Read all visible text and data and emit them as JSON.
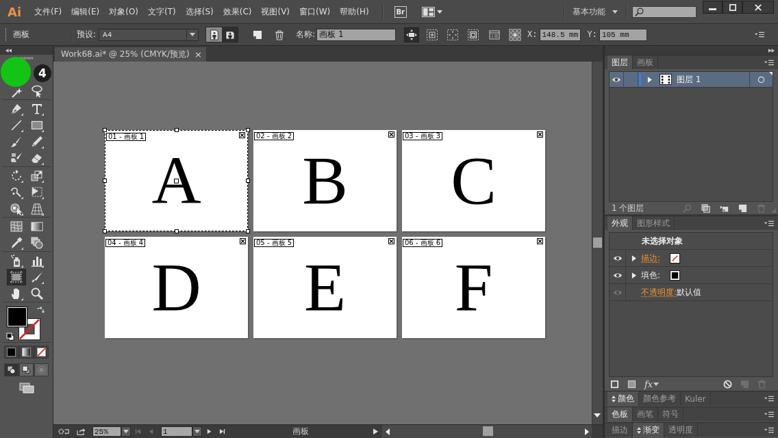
{
  "app": {
    "logo": "Ai"
  },
  "menu": [
    "文件(F)",
    "编辑(E)",
    "对象(O)",
    "文字(T)",
    "选择(S)",
    "效果(C)",
    "视图(V)",
    "窗口(W)",
    "帮助(H)"
  ],
  "title_bar": {
    "bridge": "Br",
    "workspace": "基本功能"
  },
  "control_bar": {
    "title": "画板",
    "preset_label": "预设:",
    "preset": "A4",
    "orientation": [
      {
        "kind": "portrait",
        "selected": false
      },
      {
        "kind": "landscape",
        "selected": true
      }
    ],
    "name_label": "名称:",
    "name": "画板 1",
    "toggles": [
      {
        "kind": "move",
        "selected": true
      },
      {
        "kind": "center",
        "selected": false
      },
      {
        "kind": "crosshair",
        "selected": false
      },
      {
        "kind": "safe",
        "selected": false
      }
    ],
    "x_label": "X:",
    "x": "148.5 mm",
    "y_label": "Y:",
    "y": "105 mm"
  },
  "document": {
    "tab": "Work68.ai* @ 25% (CMYK/预览)",
    "close": "×"
  },
  "tools": [
    {
      "kind": "wand",
      "selected": false
    },
    {
      "kind": "lasso",
      "selected": false
    },
    {
      "kind": "pen",
      "selected": false
    },
    {
      "kind": "type",
      "selected": false
    },
    {
      "kind": "line",
      "selected": false
    },
    {
      "kind": "rect",
      "selected": false
    },
    {
      "kind": "brush",
      "selected": false
    },
    {
      "kind": "pencil",
      "selected": false
    },
    {
      "kind": "blob",
      "selected": false
    },
    {
      "kind": "eraser",
      "selected": false
    },
    {
      "kind": "rotate",
      "selected": false
    },
    {
      "kind": "scale",
      "selected": false
    },
    {
      "kind": "warp",
      "selected": false
    },
    {
      "kind": "transform",
      "selected": false
    },
    {
      "kind": "shapebuilder",
      "selected": false
    },
    {
      "kind": "perspective",
      "selected": false
    },
    {
      "kind": "mesh",
      "selected": false
    },
    {
      "kind": "gradient",
      "selected": false
    },
    {
      "kind": "eyedropper",
      "selected": false
    },
    {
      "kind": "blend",
      "selected": false
    },
    {
      "kind": "spray",
      "selected": false
    },
    {
      "kind": "graph",
      "selected": false
    },
    {
      "kind": "artboard",
      "selected": true
    },
    {
      "kind": "slice",
      "selected": false
    },
    {
      "kind": "hand",
      "selected": false
    },
    {
      "kind": "zoom",
      "selected": false
    }
  ],
  "colors": {
    "fill": {
      "kind": "solid",
      "color": "#000000"
    },
    "stroke": {
      "kind": "none"
    }
  },
  "color_modes": [
    {
      "kind": "color"
    },
    {
      "kind": "gradient"
    },
    {
      "kind": "none"
    }
  ],
  "draw_modes": [
    {
      "kind": "normal",
      "selected": true,
      "disabled": false
    },
    {
      "kind": "behind",
      "selected": false,
      "disabled": false
    },
    {
      "kind": "inside",
      "selected": false,
      "disabled": true
    }
  ],
  "tutorial_hint": {
    "step": "4"
  },
  "artboards": [
    {
      "label": "01 - 画板 1",
      "letter": "A",
      "selected": true
    },
    {
      "label": "02 - 画板 2",
      "letter": "B",
      "selected": false
    },
    {
      "label": "03 - 画板 3",
      "letter": "C",
      "selected": false
    },
    {
      "label": "04 - 画板 4",
      "letter": "D",
      "selected": false
    },
    {
      "label": "05 - 画板 5",
      "letter": "E",
      "selected": false
    },
    {
      "label": "06 - 画板 6",
      "letter": "F",
      "selected": false
    }
  ],
  "layers_panel": {
    "tabs": [
      {
        "label": "图层",
        "selected": true
      },
      {
        "label": "画板",
        "selected": false
      }
    ],
    "layers": [
      {
        "name": "图层 1",
        "visible": true,
        "selected": true,
        "expanded": false,
        "color": "#2e7ff0"
      }
    ],
    "count": "1 个图层"
  },
  "appearance_panel": {
    "tabs": [
      {
        "label": "外观",
        "selected": true
      },
      {
        "label": "图形样式",
        "selected": false
      }
    ],
    "title": "未选择对象",
    "rows": [
      {
        "kind": "swatch",
        "label": "描边:",
        "link": true,
        "visible": true,
        "expanded": false,
        "swatch": {
          "kind": "none"
        }
      },
      {
        "kind": "swatch",
        "label": "填色:",
        "link": false,
        "visible": true,
        "expanded": false,
        "swatch": {
          "kind": "solid",
          "color": "#000000"
        }
      },
      {
        "kind": "value",
        "label": "不透明度:",
        "link": true,
        "visible": false,
        "value": "默认值"
      }
    ],
    "fx": "fx"
  },
  "collapsed_panels": [
    {
      "tabs": [
        {
          "label": "颜色",
          "selected": true,
          "options": true
        },
        {
          "label": "颜色参考",
          "selected": false,
          "options": false
        },
        {
          "label": "Kuler",
          "selected": false,
          "options": false
        }
      ]
    },
    {
      "tabs": [
        {
          "label": "色板",
          "selected": true,
          "options": false
        },
        {
          "label": "画笔",
          "selected": false,
          "options": false
        },
        {
          "label": "符号",
          "selected": false,
          "options": false
        }
      ]
    },
    {
      "tabs": [
        {
          "label": "描边",
          "selected": false,
          "options": false
        },
        {
          "label": "渐变",
          "selected": true,
          "options": true
        },
        {
          "label": "透明度",
          "selected": false,
          "options": false
        }
      ]
    }
  ],
  "status_bar": {
    "zoom": "25%",
    "nav": [
      {
        "kind": "first",
        "disabled": true
      },
      {
        "kind": "prev",
        "disabled": true
      },
      {
        "kind": "next",
        "disabled": false
      },
      {
        "kind": "last",
        "disabled": false
      }
    ],
    "artboard": "1",
    "label": "画板"
  }
}
